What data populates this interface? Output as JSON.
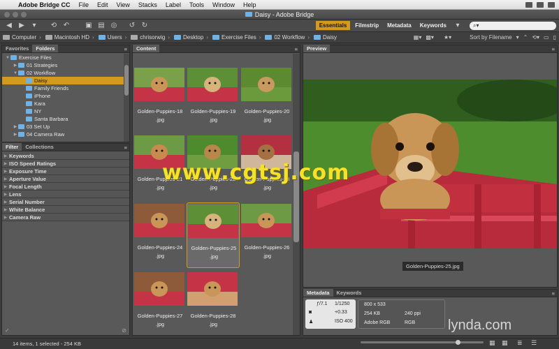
{
  "menubar": {
    "app": "Adobe Bridge CC",
    "items": [
      "File",
      "Edit",
      "View",
      "Stacks",
      "Label",
      "Tools",
      "Window",
      "Help"
    ]
  },
  "window": {
    "title": "Daisy - Adobe Bridge"
  },
  "workspaces": [
    "Essentials",
    "Filmstrip",
    "Metadata",
    "Keywords"
  ],
  "workspace_active": "Essentials",
  "search": {
    "placeholder": "⌕▾"
  },
  "path": [
    "Computer",
    "Macintosh HD",
    "Users",
    "chrisorwig",
    "Desktop",
    "Exercise Files",
    "02 Workflow",
    "Daisy"
  ],
  "sort_label": "Sort by Filename",
  "left_tabs": [
    "Favorites",
    "Folders"
  ],
  "folders": [
    {
      "label": "Exercise Files",
      "level": 0,
      "open": true
    },
    {
      "label": "01 Strategies",
      "level": 1,
      "open": false
    },
    {
      "label": "02 Workflow",
      "level": 1,
      "open": true
    },
    {
      "label": "Daisy",
      "level": 2,
      "selected": true
    },
    {
      "label": "Family Friends",
      "level": 2
    },
    {
      "label": "iPhone",
      "level": 2
    },
    {
      "label": "Kara",
      "level": 2
    },
    {
      "label": "NY",
      "level": 2
    },
    {
      "label": "Santa Barbara",
      "level": 2
    },
    {
      "label": "03 Set Up",
      "level": 1
    },
    {
      "label": "04 Camera Raw",
      "level": 1
    }
  ],
  "filter_tabs": [
    "Filter",
    "Collections"
  ],
  "filters": [
    "Keywords",
    "ISO Speed Ratings",
    "Exposure Time",
    "Aperture Value",
    "Focal Length",
    "Lens",
    "Serial Number",
    "White Balance",
    "Camera Raw"
  ],
  "content_tab": "Content",
  "thumbnails": [
    {
      "name": "Golden-Puppies-18",
      "ext": ".jpg"
    },
    {
      "name": "Golden-Puppies-19",
      "ext": ".jpg"
    },
    {
      "name": "Golden-Puppies-20",
      "ext": ".jpg"
    },
    {
      "name": "Golden-Puppies-21",
      "ext": ".jpg"
    },
    {
      "name": "Golden-Puppies-22",
      "ext": ".jpg"
    },
    {
      "name": "Golden-Puppies-23",
      "ext": ".jpg"
    },
    {
      "name": "Golden-Puppies-24",
      "ext": ".jpg"
    },
    {
      "name": "Golden-Puppies-25",
      "ext": ".jpg",
      "selected": true
    },
    {
      "name": "Golden-Puppies-26",
      "ext": ".jpg"
    },
    {
      "name": "Golden-Puppies-27",
      "ext": ".jpg"
    },
    {
      "name": "Golden-Puppies-28",
      "ext": ".jpg"
    }
  ],
  "preview_tab": "Preview",
  "preview_caption": "Golden-Puppies-25.jpg",
  "meta_tabs": [
    "Metadata",
    "Keywords"
  ],
  "metadata": {
    "aperture": "ƒ/7.1",
    "shutter": "1/1250",
    "exposure_comp": "+0.33",
    "iso": "ISO 400",
    "dimensions": "800 x 533",
    "filesize": "254 KB",
    "resolution": "240 ppi",
    "colorprofile": "Adobe RGB",
    "colormode": "RGB"
  },
  "status": "14 items, 1 selected - 254 KB",
  "thumb_size": 0.8,
  "watermark": "www.cgtsj.com",
  "logo": "lynda.com",
  "colors": {
    "accent": "#d29b1e",
    "folder": "#6db3e8"
  }
}
